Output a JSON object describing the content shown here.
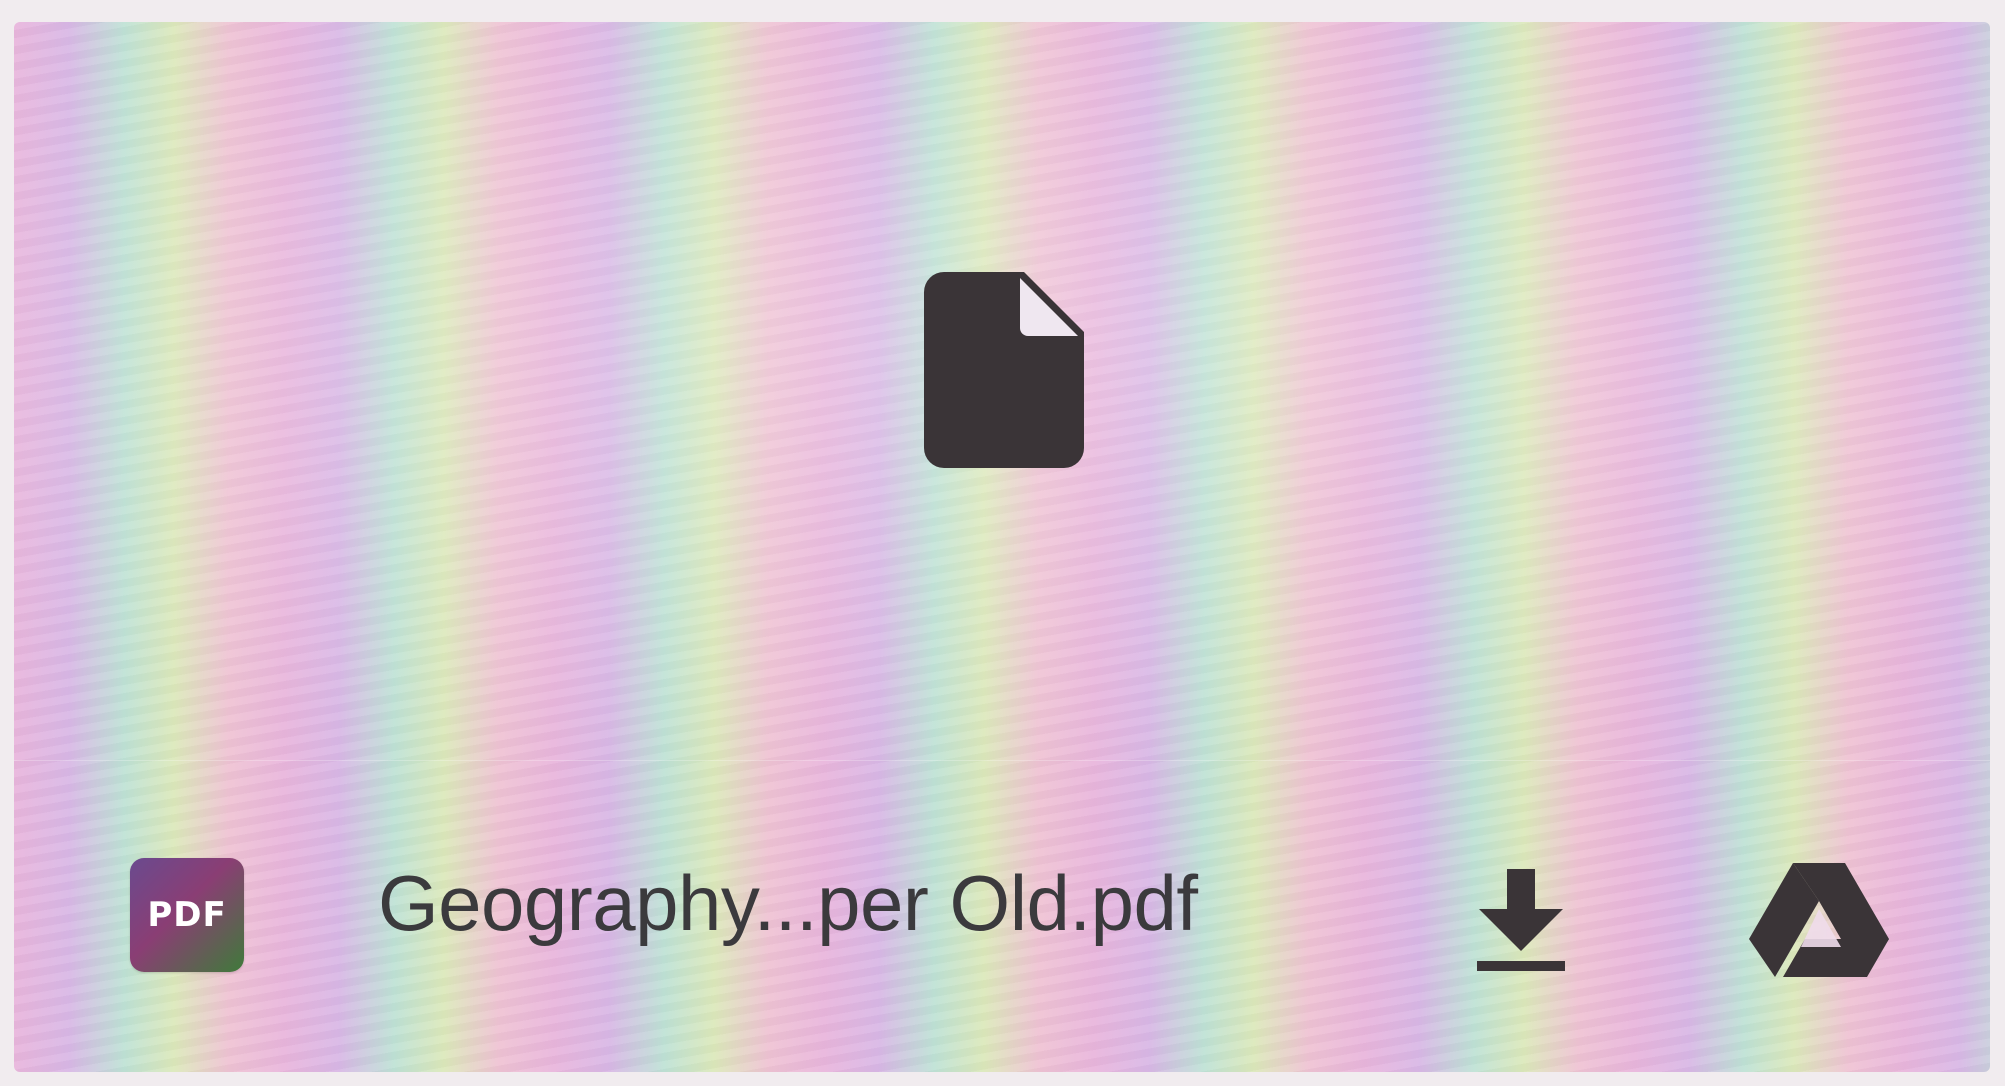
{
  "attachment": {
    "file_type_badge": "PDF",
    "file_name": "Geography...per Old.pdf",
    "preview_icon": "file-icon",
    "actions": [
      {
        "name": "download",
        "icon": "download-icon"
      },
      {
        "name": "save-to-drive",
        "icon": "google-drive-icon"
      }
    ]
  },
  "colors": {
    "icon": "#3a3437",
    "text": "#3b3a3d",
    "badge_start": "#6a4a8f",
    "badge_end": "#3f7a3a"
  }
}
